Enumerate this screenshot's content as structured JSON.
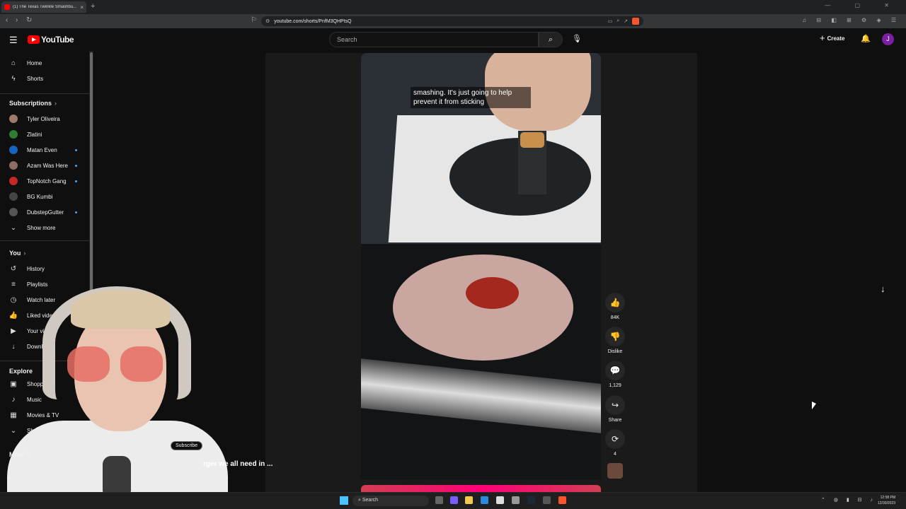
{
  "browser": {
    "tab_title": "(1) The Texas Twinkle Smashbu...",
    "tab_close": "×",
    "new_tab": "+",
    "url": "youtube.com/shorts/PnfM3QHPtsQ",
    "window_controls": "— ▢ ✕",
    "extensions": "♫ ⊟ ◧ ⊞ ⚙ ◈ ☰"
  },
  "header": {
    "logo_text": "YouTube",
    "search_placeholder": "Search",
    "create_label": "Create",
    "avatar_letter": "J"
  },
  "sidebar": {
    "home": "Home",
    "shorts": "Shorts",
    "subscriptions_heading": "Subscriptions",
    "channels": [
      {
        "name": "Tyler Oliveira",
        "color": "#a07a6a",
        "new": false
      },
      {
        "name": "Zlatini",
        "color": "#2e7d32",
        "new": false
      },
      {
        "name": "Matan Even",
        "color": "#1565c0",
        "new": true
      },
      {
        "name": "Azam Was Here",
        "color": "#8d6e63",
        "new": true
      },
      {
        "name": "TopNotch Gang",
        "color": "#c62828",
        "new": true
      },
      {
        "name": "BG Kumbi",
        "color": "#444444",
        "new": false
      },
      {
        "name": "DubstepGutter",
        "color": "#555555",
        "new": true
      }
    ],
    "show_more": "Show more",
    "you_heading": "You",
    "you_items": [
      "History",
      "Playlists",
      "Watch later",
      "Liked videos",
      "Your videos",
      "Downlo"
    ],
    "explore_heading": "Explore",
    "explore_items": [
      "Shopp",
      "Music",
      "Movies & TV"
    ],
    "show_more_2": "Show more",
    "more_from": "More fr"
  },
  "short": {
    "caption": "smashing. It's just going to help prevent it from sticking",
    "likes": "84K",
    "dislike_label": "Dislike",
    "comments": "1,129",
    "share_label": "Share",
    "remix_count": "4"
  },
  "overlay": {
    "subscribe_label": "Subscribe",
    "title_fragment": "rger we all need in ..."
  },
  "taskbar": {
    "search_label": "Search",
    "time": "12:58 PM",
    "date": "12/30/2023"
  }
}
